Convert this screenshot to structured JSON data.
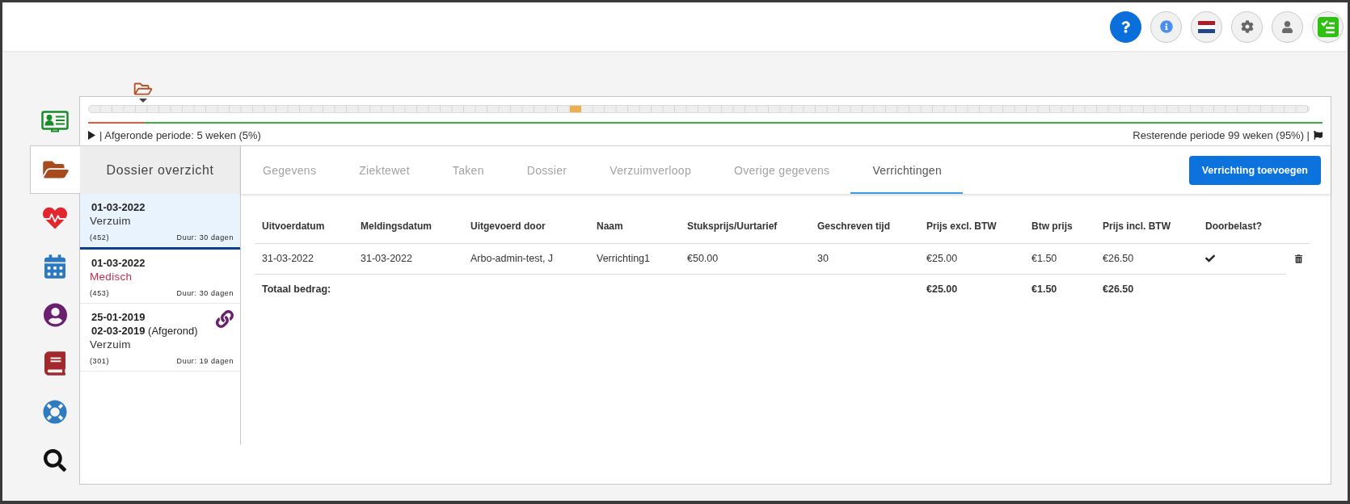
{
  "timeline": {
    "marker": {
      "level": 0.394
    },
    "progress": {
      "level": 0.045
    },
    "completed_text": "| Afgeronde periode: 5 weken (5%)",
    "remaining_text": "Resterende periode 99 weken (95%) |"
  },
  "sidebar": {
    "items": [
      {
        "selected": false
      },
      {
        "selected": true
      },
      {
        "selected": false
      },
      {
        "selected": false
      },
      {
        "selected": false
      },
      {
        "selected": false
      },
      {
        "selected": false
      },
      {
        "selected": false
      }
    ]
  },
  "dossier": {
    "title": "Dossier overzicht",
    "items": [
      {
        "selected": true,
        "start_date": "01-03-2022",
        "type": "Verzuim",
        "color": "#333333",
        "number": "(452)",
        "duration": "Duur: 30 dagen",
        "linked": false
      },
      {
        "selected": false,
        "start_date": "01-03-2022",
        "type": "Medisch",
        "color": "#c2304f",
        "number": "(453)",
        "duration": "Duur: 30 dagen",
        "linked": false
      },
      {
        "selected": false,
        "start_date": "25-01-2019",
        "end_date": "02-03-2019",
        "status": "(Afgerond)",
        "type": "Verzuim",
        "color": "#333333",
        "number": "(301)",
        "duration": "Duur: 19 dagen",
        "linked": true
      }
    ]
  },
  "tabs": [
    {
      "label": "Gegevens",
      "selected": false
    },
    {
      "label": "Ziektewet",
      "selected": false
    },
    {
      "label": "Taken",
      "selected": false
    },
    {
      "label": "Dossier",
      "selected": false
    },
    {
      "label": "Verzuimverloop",
      "selected": false
    },
    {
      "label": "Overige gegevens",
      "selected": false
    },
    {
      "label": "Verrichtingen",
      "selected": true
    }
  ],
  "add_button": "Verrichting toevoegen",
  "table": {
    "columns": [
      "Uitvoerdatum",
      "Meldingsdatum",
      "Uitgevoerd door",
      "Naam",
      "Stuksprijs/Uurtarief",
      "Geschreven tijd",
      "Prijs excl. BTW",
      "Btw prijs",
      "Prijs incl. BTW",
      "Doorbelast?"
    ],
    "rows": [
      {
        "cells": [
          "31-03-2022",
          "31-03-2022",
          "Arbo-admin-test, J",
          "Verrichting1",
          "€50.00",
          "30",
          "€25.00",
          "€1.50",
          "€26.50"
        ],
        "charged": true
      }
    ],
    "total": {
      "label": "Totaal bedrag:",
      "price_excl": "€25.00",
      "vat": "€1.50",
      "price_incl": "€26.50"
    }
  }
}
